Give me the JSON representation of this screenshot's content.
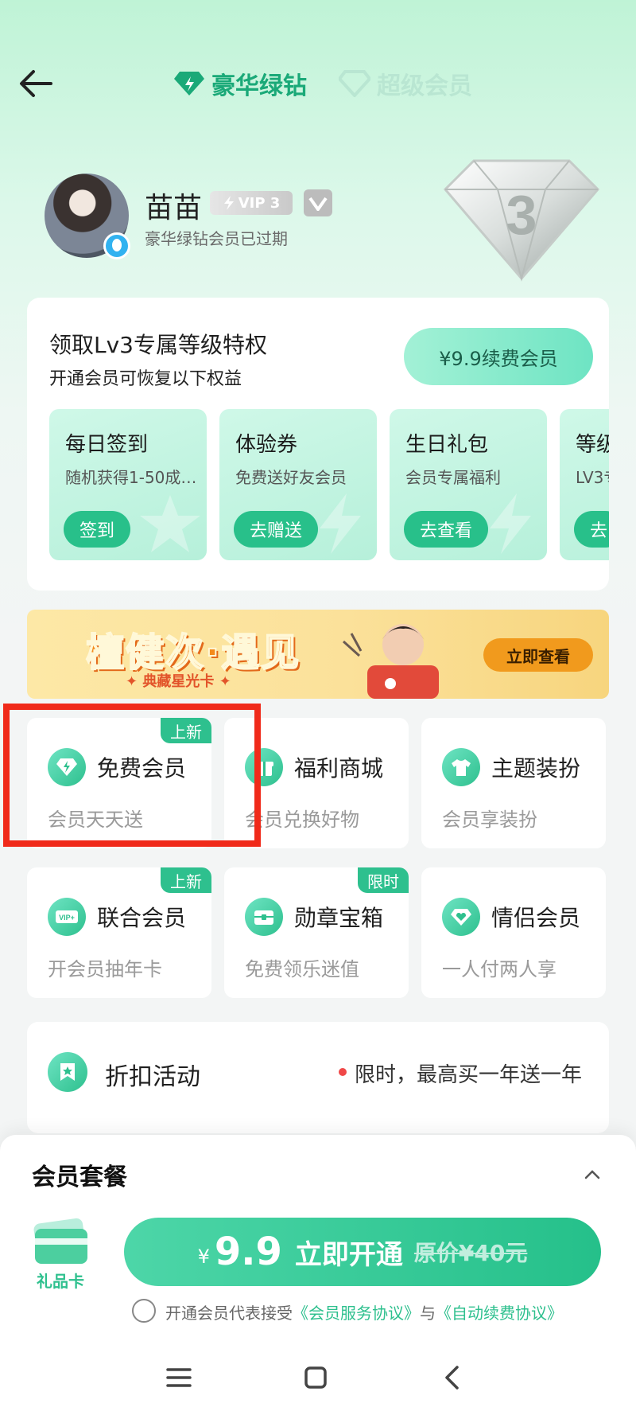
{
  "header": {
    "tab_active": "豪华绿钻",
    "tab_inactive": "超级会员"
  },
  "profile": {
    "username": "苗苗",
    "vip_badge": "VIP 3",
    "status": "豪华绿钻会员已过期",
    "level": "3"
  },
  "privilege": {
    "title": "领取Lv3专属等级特权",
    "subtitle": "开通会员可恢复以下权益",
    "renew_button": "¥9.9续费会员",
    "perks": [
      {
        "name": "每日签到",
        "desc": "随机获得1-50成…",
        "button": "签到"
      },
      {
        "name": "体验券",
        "desc": "免费送好友会员",
        "button": "去赠送"
      },
      {
        "name": "生日礼包",
        "desc": "会员专属福利",
        "button": "去查看"
      },
      {
        "name": "等级",
        "desc": "LV3专",
        "button": "去"
      }
    ]
  },
  "banner": {
    "title": "檀健次·遇见",
    "subtitle": "✦ 典藏星光卡 ✦",
    "button": "立即查看"
  },
  "features": [
    {
      "title": "免费会员",
      "sub": "会员天天送",
      "tag": "上新",
      "icon": "diamond-bolt-icon"
    },
    {
      "title": "福利商城",
      "sub": "会员兑换好物",
      "tag": "",
      "icon": "gift-icon"
    },
    {
      "title": "主题装扮",
      "sub": "会员享装扮",
      "tag": "",
      "icon": "shirt-icon"
    },
    {
      "title": "联合会员",
      "sub": "开会员抽年卡",
      "tag": "上新",
      "icon": "vip-plus-icon"
    },
    {
      "title": "勋章宝箱",
      "sub": "免费领乐迷值",
      "tag": "限时",
      "icon": "treasure-chest-icon"
    },
    {
      "title": "情侣会员",
      "sub": "一人付两人享",
      "tag": "",
      "icon": "heart-diamond-icon"
    }
  ],
  "discount": {
    "title": "折扣活动",
    "text": "限时，最高买一年送一年"
  },
  "sheet": {
    "title": "会员套餐",
    "gift_label": "礼品卡",
    "currency": "¥",
    "price": "9.9",
    "cta": "立即开通",
    "original": "原价¥40元",
    "agree_prefix": "开通会员代表接受",
    "agree_link1": "《会员服务协议》",
    "agree_mid": "与",
    "agree_link2": "《自动续费协议》"
  },
  "colors": {
    "accent": "#2ec08e",
    "highlight_border": "#f02a1a",
    "banner_orange": "#f19a1d"
  }
}
